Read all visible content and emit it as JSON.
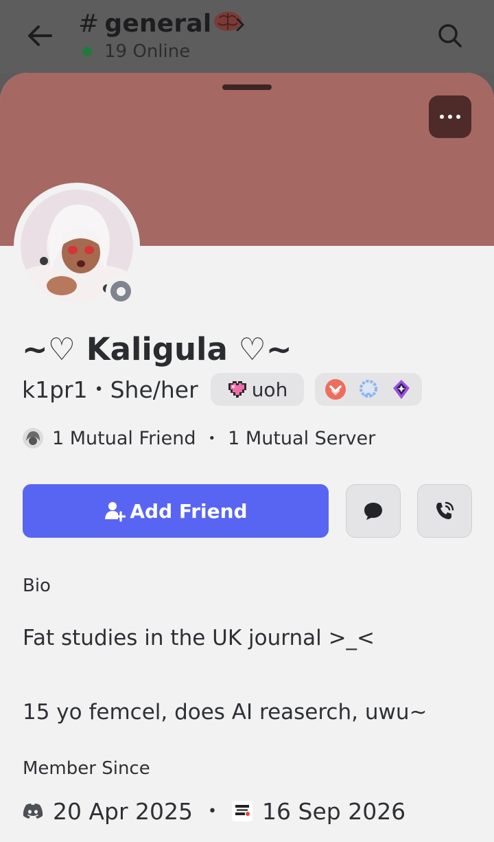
{
  "header": {
    "channel_hash": "#",
    "channel_name": "general",
    "online_text": "19 Online"
  },
  "profile": {
    "display_name": "~♡ Kaligula ♡~",
    "username": "k1pr1",
    "pronouns": "She/her",
    "separator": "•",
    "tag_label": "uoh",
    "mutual_friends": "1 Mutual Friend",
    "mutual_servers": "1 Mutual Server",
    "add_friend_label": "Add Friend",
    "bio_label": "Bio",
    "bio_text": "Fat studies in the UK journal >_<\n\n15 yo femcel, does AI reaserch, uwu~",
    "member_since_label": "Member Since",
    "discord_member_since": "20 Apr 2025",
    "server_member_since": "16 Sep 2026"
  },
  "colors": {
    "banner": "#a56863",
    "accent": "#5865f2",
    "sheet_bg": "#f2f2f2"
  },
  "icons": [
    "back-arrow-icon",
    "brain-emoji-icon",
    "chevron-right-icon",
    "search-icon",
    "more-dots-icon",
    "offline-status-icon",
    "pixel-heart-icon",
    "nitro-boost-badge-icon",
    "quest-badge-icon",
    "nitro-badge-icon",
    "add-friend-icon",
    "message-icon",
    "call-icon",
    "discord-icon",
    "server-icon"
  ]
}
